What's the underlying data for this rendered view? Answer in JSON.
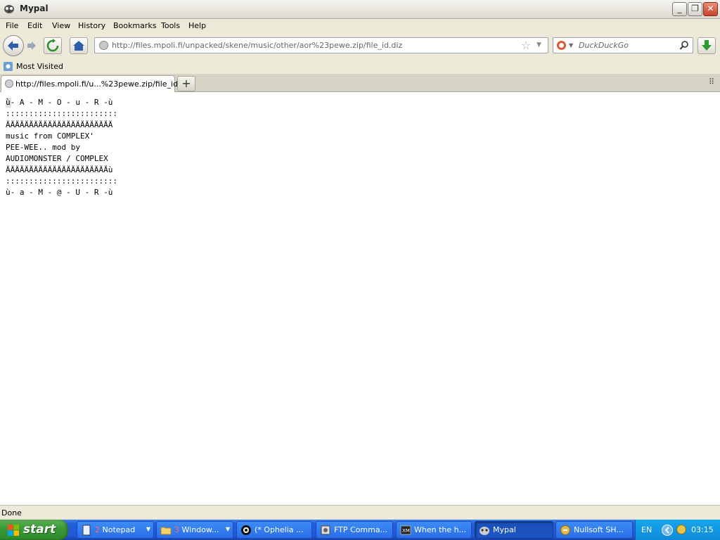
{
  "window": {
    "title": "Mypal"
  },
  "menu": [
    "File",
    "Edit",
    "View",
    "History",
    "Bookmarks",
    "Tools",
    "Help"
  ],
  "nav": {
    "url": "http://files.mpoli.fi/unpacked/skene/music/other/aor%23pewe.zip/file_id.diz",
    "search_placeholder": "DuckDuckGo"
  },
  "bookmarks": {
    "most_visited": "Most Visited"
  },
  "tabs": [
    {
      "label": "http://files.mpoli.fi/u...%23pewe.zip/file_id.diz",
      "active": true
    }
  ],
  "content": {
    "lines": [
      "ù- A - M - O - u - R -ù",
      "::::::::::::::::::::::::",
      "ÄÄÄÄÄÄÄÄÄÄÄÄÄÄÄÄÄÄÄÄÄÄÄ",
      "music from COMPLEX'",
      "PEE-WEE.. mod by",
      "AUDIOMONSTER / COMPLEX",
      "ÄÄÄÄÄÄÄÄÄÄÄÄÄÄÄÄÄÄÄÄÄÄù",
      "::::::::::::::::::::::::",
      "ù- a - M - @ - U - R -ù"
    ]
  },
  "status": {
    "text": "Done"
  },
  "taskbar": {
    "start": "start",
    "tasks": [
      {
        "num": "2",
        "label": "Notepad",
        "icon": "notepad-icon",
        "group": true
      },
      {
        "num": "3",
        "label": "Window...",
        "icon": "folder-icon",
        "group": true
      },
      {
        "num": "",
        "label": "(* Ophelia ...",
        "icon": "player-icon",
        "group": false
      },
      {
        "num": "",
        "label": "FTP Comma...",
        "icon": "ftp-icon",
        "group": false
      },
      {
        "num": "",
        "label": "When the h...",
        "icon": "xm-icon",
        "group": false
      },
      {
        "num": "",
        "label": "Mypal",
        "icon": "mypal-icon",
        "group": false,
        "active": true
      },
      {
        "num": "",
        "label": "Nullsoft SH...",
        "icon": "installer-icon",
        "group": false
      }
    ],
    "tray": {
      "lang": "EN",
      "clock": "03:15"
    }
  },
  "colors": {
    "taskbar": "#245edb",
    "start": "#3c9a37",
    "tray": "#0f8ad8"
  }
}
